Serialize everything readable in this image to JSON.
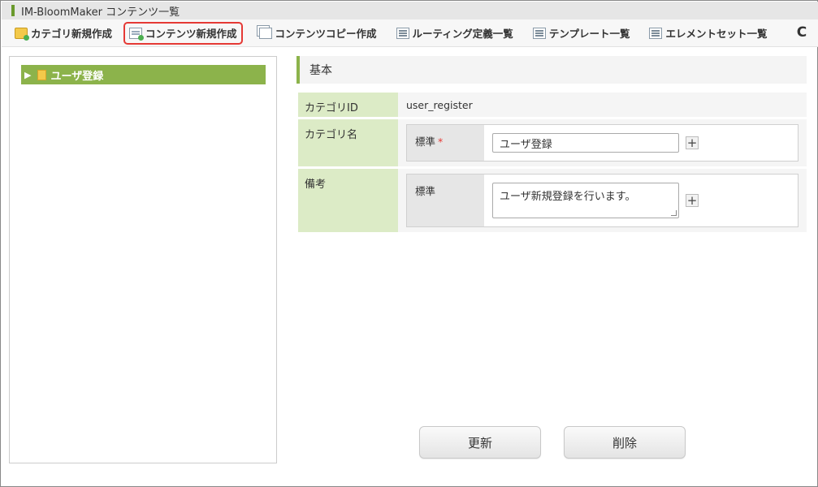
{
  "window": {
    "title": "IM-BloomMaker コンテンツ一覧"
  },
  "toolbar": {
    "items": [
      {
        "label": "カテゴリ新規作成",
        "icon": "folder-add-icon"
      },
      {
        "label": "コンテンツ新規作成",
        "icon": "page-add-icon",
        "highlighted": true
      },
      {
        "label": "コンテンツコピー作成",
        "icon": "copy-icon"
      },
      {
        "label": "ルーティング定義一覧",
        "icon": "list-icon"
      },
      {
        "label": "テンプレート一覧",
        "icon": "list-icon"
      },
      {
        "label": "エレメントセット一覧",
        "icon": "list-icon"
      }
    ],
    "refresh_icon": "C"
  },
  "tree": {
    "items": [
      {
        "label": "ユーザ登録",
        "expanded": false,
        "selected": true
      }
    ]
  },
  "section": {
    "title": "基本"
  },
  "form": {
    "category_id": {
      "label": "カテゴリID",
      "value": "user_register"
    },
    "category_name": {
      "label": "カテゴリ名",
      "locale_label": "標準",
      "required_mark": "*",
      "value": "ユーザ登録"
    },
    "note": {
      "label": "備考",
      "locale_label": "標準",
      "value": "ユーザ新規登録を行います。"
    },
    "add_symbol": "+"
  },
  "buttons": {
    "update": "更新",
    "delete": "削除"
  },
  "colors": {
    "accent_green": "#8cb34b",
    "label_bg": "#dcebc6",
    "highlight_red": "#e53935"
  }
}
